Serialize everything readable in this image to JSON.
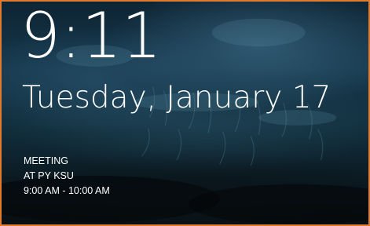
{
  "lock_screen": {
    "time": "9:11",
    "date": "Tuesday, January 17",
    "event": {
      "title": "MEETING",
      "location": "AT PY KSU",
      "time_range": "9:00 AM - 10:00 AM"
    }
  },
  "colors": {
    "border": "#e07a2e",
    "text": "#ffffff",
    "background_dark": "#0b1a22"
  }
}
